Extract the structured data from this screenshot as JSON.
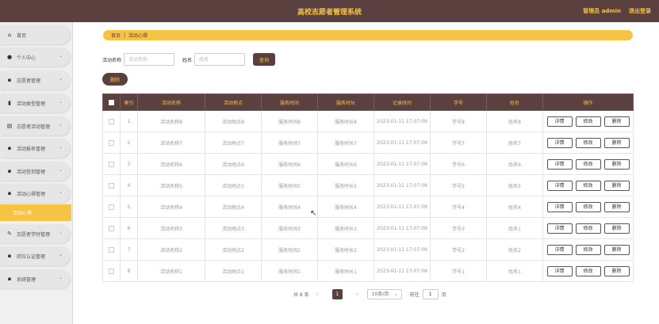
{
  "header": {
    "title": "高校志愿者管理系统",
    "admin_label": "管理员 admin",
    "logout_label": "退出登录"
  },
  "sidebar": {
    "items": [
      {
        "label": "首页",
        "icon": "home-icon",
        "glyph": "⌂"
      },
      {
        "label": "个人中心",
        "icon": "user-icon",
        "glyph": "●"
      },
      {
        "label": "志愿者管理",
        "icon": "grid-icon",
        "glyph": "▪"
      },
      {
        "label": "活动类型管理",
        "icon": "bar-chart-icon",
        "glyph": "▮"
      },
      {
        "label": "志愿者活动管理",
        "icon": "list-icon",
        "glyph": "▤"
      },
      {
        "label": "活动报名管理",
        "icon": "grid-icon",
        "glyph": "▪"
      },
      {
        "label": "活动签到管理",
        "icon": "grid-icon",
        "glyph": "▪"
      },
      {
        "label": "活动心得管理",
        "icon": "grid-icon",
        "glyph": "▪"
      },
      {
        "label": "活动心得",
        "sub": true
      },
      {
        "label": "志愿者学时管理",
        "icon": "edit-icon",
        "glyph": "✎"
      },
      {
        "label": "岗位认证管理",
        "icon": "grid-icon",
        "glyph": "▪"
      },
      {
        "label": "系统管理",
        "icon": "grid-icon",
        "glyph": "▪"
      }
    ]
  },
  "breadcrumb": {
    "home": "首页",
    "separator": "|",
    "current": "活动心得"
  },
  "filter": {
    "name_label": "活动名称",
    "name_placeholder": "活动名称",
    "person_label": "姓名",
    "person_placeholder": "姓名",
    "search_label": "查询"
  },
  "delete_label": "删除",
  "table": {
    "headers": [
      "索引",
      "活动名称",
      "活动地点",
      "服务时间",
      "服务时长",
      "记录时间",
      "学号",
      "姓名",
      "操作"
    ],
    "rows": [
      {
        "index": "1",
        "name": "活动名称8",
        "place": "活动地点8",
        "time": "服务时间8",
        "duration": "服务时长8",
        "recorded": "2023-01-11 17:07:09",
        "student_id": "学号8",
        "person": "姓名8"
      },
      {
        "index": "2",
        "name": "活动名称7",
        "place": "活动地点7",
        "time": "服务时间7",
        "duration": "服务时长7",
        "recorded": "2023-01-11 17:07:09",
        "student_id": "学号7",
        "person": "姓名7"
      },
      {
        "index": "3",
        "name": "活动名称6",
        "place": "活动地点6",
        "time": "服务时间6",
        "duration": "服务时长6",
        "recorded": "2023-01-11 17:07:09",
        "student_id": "学号6",
        "person": "姓名6"
      },
      {
        "index": "4",
        "name": "活动名称5",
        "place": "活动地点5",
        "time": "服务时间5",
        "duration": "服务时长5",
        "recorded": "2023-01-11 17:07:09",
        "student_id": "学号5",
        "person": "姓名5"
      },
      {
        "index": "5",
        "name": "活动名称4",
        "place": "活动地点4",
        "time": "服务时间4",
        "duration": "服务时长4",
        "recorded": "2023-01-11 17:07:09",
        "student_id": "学号4",
        "person": "姓名4"
      },
      {
        "index": "6",
        "name": "活动名称3",
        "place": "活动地点3",
        "time": "服务时间3",
        "duration": "服务时长3",
        "recorded": "2023-01-11 17:07:09",
        "student_id": "学号3",
        "person": "姓名1"
      },
      {
        "index": "7",
        "name": "活动名称2",
        "place": "活动地点2",
        "time": "服务时间2",
        "duration": "服务时长2",
        "recorded": "2023-01-11 17:07:09",
        "student_id": "学号2",
        "person": "姓名2"
      },
      {
        "index": "8",
        "name": "活动名称1",
        "place": "活动地点1",
        "time": "服务时间1",
        "duration": "服务时长1",
        "recorded": "2023-01-11 17:07:09",
        "student_id": "学号1",
        "person": "姓名1"
      }
    ],
    "actions": {
      "detail": "详情",
      "edit": "修改",
      "delete": "删除"
    }
  },
  "pagination": {
    "total": "共 8 条",
    "prev": "<",
    "current_page": "1",
    "next": ">",
    "page_size": "10条/页",
    "goto_label": "前往",
    "goto_value": "1",
    "page_suffix": "页"
  },
  "colors": {
    "primary": "#5b4040",
    "accent": "#f6c344"
  }
}
